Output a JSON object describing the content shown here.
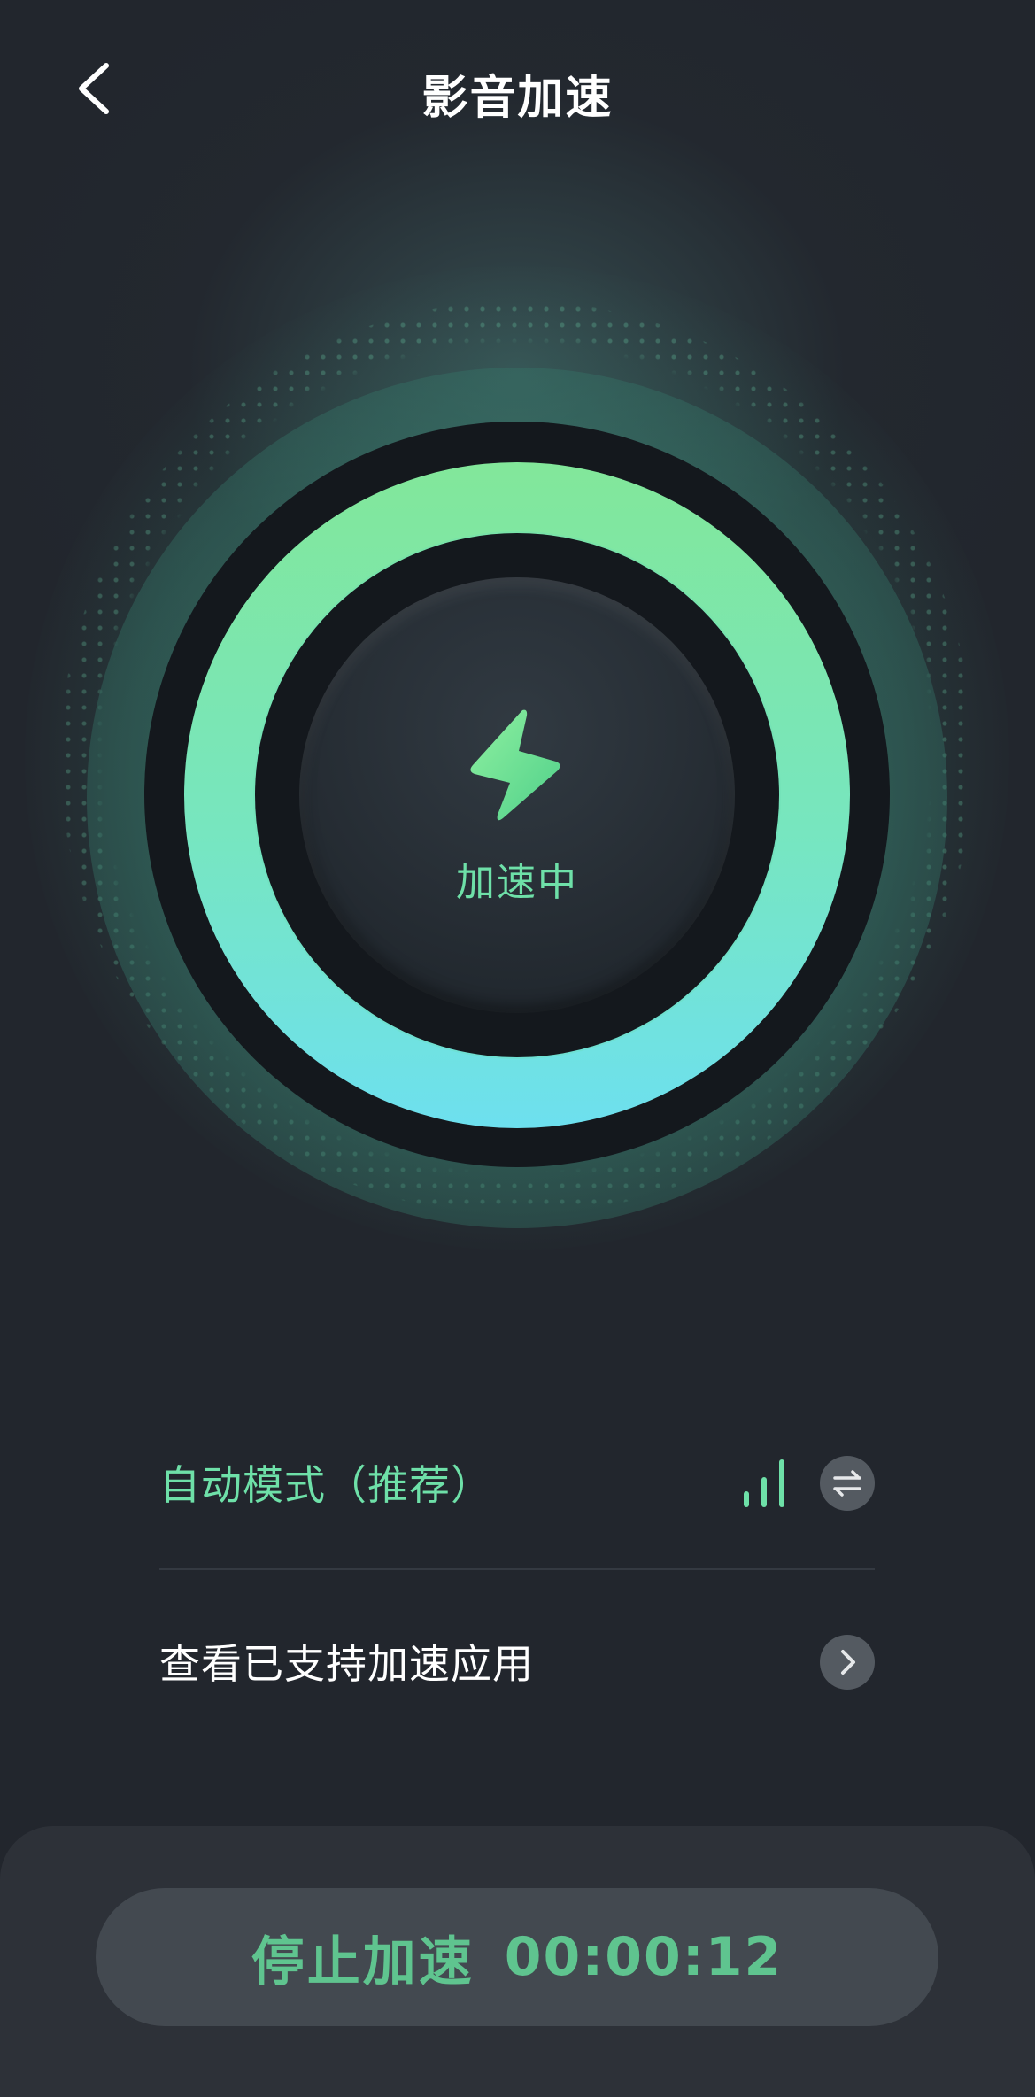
{
  "header": {
    "title": "影音加速",
    "back_icon": "chevron-left-icon"
  },
  "dial": {
    "status": "加速中",
    "center_icon": "lightning-bolt-icon",
    "accent_gradient": [
      "#82e79a",
      "#6de0ef"
    ]
  },
  "options": [
    {
      "label": "自动模式（推荐）",
      "indicator_icon": "signal-strength-icon",
      "action_icon": "switch-arrows-icon"
    },
    {
      "label": "查看已支持加速应用",
      "action_icon": "chevron-right-icon"
    }
  ],
  "footer": {
    "stop_label": "停止加速",
    "timer": "00:00:12"
  },
  "colors": {
    "accent": "#6ee0a8",
    "background": "#22262d",
    "button_bg": "#434950",
    "button_text": "#5fc48f"
  }
}
